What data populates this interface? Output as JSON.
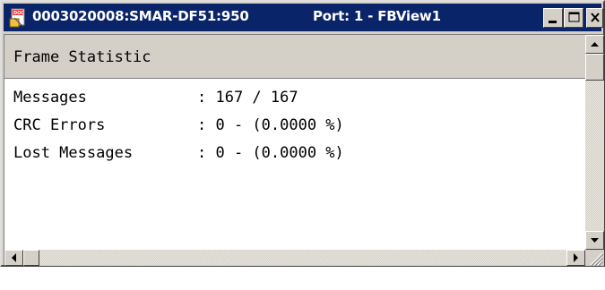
{
  "window": {
    "title": "0003020008:SMAR-DF51:950",
    "port": "Port: 1 - FBView1",
    "icon": "doc-icon"
  },
  "panel": {
    "header": "Frame Statistic",
    "rows": [
      {
        "label": "Messages",
        "value": ": 167 / 167"
      },
      {
        "label": "CRC Errors",
        "value": ": 0 - (0.0000 %)"
      },
      {
        "label": "Lost Messages",
        "value": ": 0 - (0.0000 %)"
      }
    ]
  },
  "colors": {
    "titlebar": "#0a246a",
    "chrome": "#d4d0c8"
  }
}
